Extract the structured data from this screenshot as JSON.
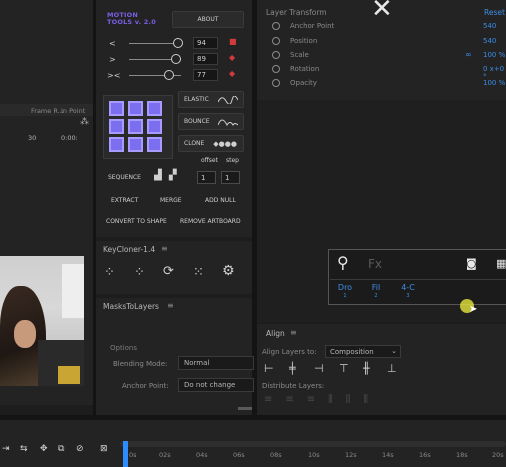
{
  "left_panel": {
    "columns": [
      "Frame R...",
      "In Point"
    ],
    "row_values": [
      "30",
      "0:00:"
    ]
  },
  "motion_tools": {
    "logo": "MOTION\nTOOLS v. 2.0",
    "about_label": "ABOUT",
    "sliders": [
      {
        "icon": "<",
        "value": "94"
      },
      {
        "icon": ">",
        "value": "89"
      },
      {
        "icon": "><",
        "value": "77"
      }
    ],
    "elastic_label": "ELASTIC",
    "bounce_label": "BOUNCE",
    "clone_label": "CLONE",
    "offset_label": "offset",
    "step_label": "step",
    "sequence_label": "SEQUENCE",
    "offset_value": "1",
    "step_value": "1",
    "extract_label": "EXTRACT",
    "merge_label": "MERGE",
    "add_null_label": "ADD NULL",
    "convert_label": "CONVERT TO SHAPE",
    "remove_artboard_label": "REMOVE ARTBOARD"
  },
  "keycloner": {
    "title": "KeyCloner-1.4"
  },
  "masks": {
    "title": "MasksToLayers",
    "options_label": "Options",
    "blending_label": "Blending Mode:",
    "blending_value": "Normal",
    "anchor_label": "Anchor Point:",
    "anchor_value": "Do not change"
  },
  "layer_transform": {
    "title": "Layer Transform",
    "reset_label": "Reset",
    "properties": [
      {
        "label": "Anchor Point",
        "value": "540"
      },
      {
        "label": "Position",
        "value": "540"
      },
      {
        "label": "Scale",
        "value": "100 %"
      },
      {
        "label": "Rotation",
        "value": "0 x+0 °"
      },
      {
        "label": "Opacity",
        "value": "100 %"
      }
    ]
  },
  "search": {
    "placeholder": "Fx",
    "chips": [
      {
        "label": "Dro",
        "index": "1"
      },
      {
        "label": "Fil",
        "index": "2"
      },
      {
        "label": "4-C",
        "index": "3"
      }
    ]
  },
  "align": {
    "title": "Align",
    "align_to_label": "Align Layers to:",
    "align_to_value": "Composition",
    "distribute_label": "Distribute Layers:"
  },
  "timeline": {
    "ticks": [
      "0s",
      "02s",
      "04s",
      "06s",
      "08s",
      "10s",
      "12s",
      "14s",
      "16s",
      "18s",
      "20s"
    ]
  },
  "colors": {
    "accent_purple": "#7b6ff0",
    "link_blue": "#3d8de6",
    "keyframe_red": "#d23b3b",
    "playhead_blue": "#2d8cff"
  }
}
